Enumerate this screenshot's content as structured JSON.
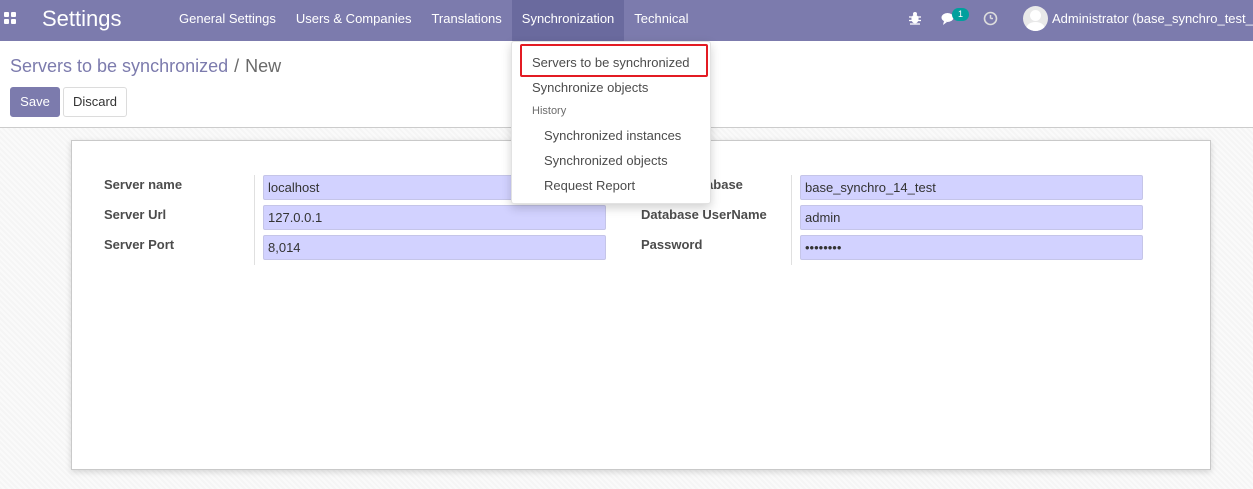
{
  "navbar": {
    "brand": "Settings",
    "menu": [
      {
        "label": "General Settings"
      },
      {
        "label": "Users & Companies"
      },
      {
        "label": "Translations"
      },
      {
        "label": "Synchronization"
      },
      {
        "label": "Technical"
      }
    ],
    "chat_badge": "1",
    "user": "Administrator (base_synchro_test_",
    "colors": {
      "bar": "#7c7bad",
      "active": "#6a6a9e",
      "badge": "#00a09d"
    }
  },
  "breadcrumb": {
    "parent": "Servers to be synchronized",
    "separator": "/",
    "current": "New"
  },
  "buttons": {
    "save": "Save",
    "discard": "Discard"
  },
  "form": {
    "left": [
      {
        "label": "Server name",
        "value": "localhost"
      },
      {
        "label": "Server Url",
        "value": "127.0.0.1"
      },
      {
        "label": "Server Port",
        "value": "8,014"
      }
    ],
    "right": [
      {
        "label": "Server Database",
        "value": "base_synchro_14_test"
      },
      {
        "label": "Database UserName",
        "value": "admin"
      },
      {
        "label": "Password",
        "value": "••••••••"
      }
    ]
  },
  "dropdown": {
    "items": [
      "Servers to be synchronized",
      "Synchronize objects"
    ],
    "history_header": "History",
    "history_items": [
      "Synchronized instances",
      "Synchronized objects",
      "Request Report"
    ],
    "highlight_color": "#e31b23"
  }
}
